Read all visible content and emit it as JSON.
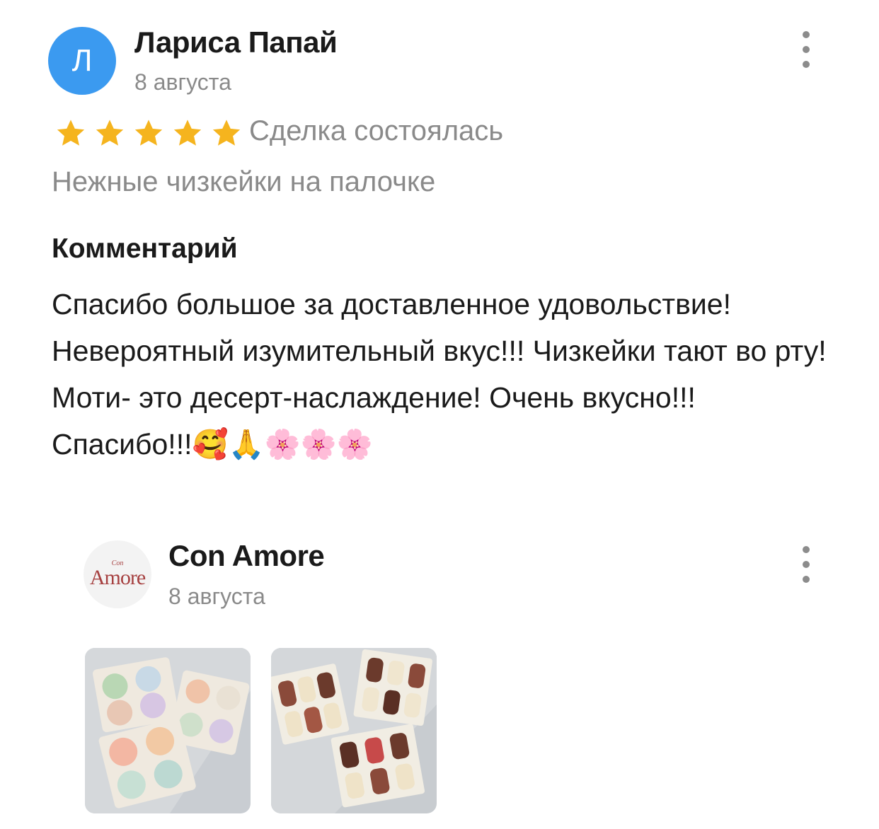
{
  "review": {
    "author_initial": "Л",
    "author_name": "Лариса Папай",
    "date": "8 августа",
    "rating": 5,
    "deal_status": "Сделка состоялась",
    "product_name": "Нежные чизкейки на палочке",
    "comment_heading": "Комментарий",
    "comment_text": "Спасибо большое за доставленное удовольствие! Невероятный изумительный вкус!!! Чизкейки тают во рту! Моти- это десерт-наслаждение! Очень вкусно!!! Спасибо!!!🥰🙏🌸🌸🌸",
    "menu_icon": "more-vertical-icon"
  },
  "reply": {
    "seller_name": "Con Amore",
    "date": "8 августа",
    "logo_text_small": "Con",
    "logo_text_big": "Amore",
    "menu_icon": "more-vertical-icon",
    "photos": [
      "mochi-boxes-photo",
      "cheesecake-pops-boxes-photo"
    ]
  },
  "colors": {
    "avatar": "#3b9af0",
    "star": "#f5b41e",
    "muted_text": "#8a8a8a",
    "logo": "#a64040"
  }
}
